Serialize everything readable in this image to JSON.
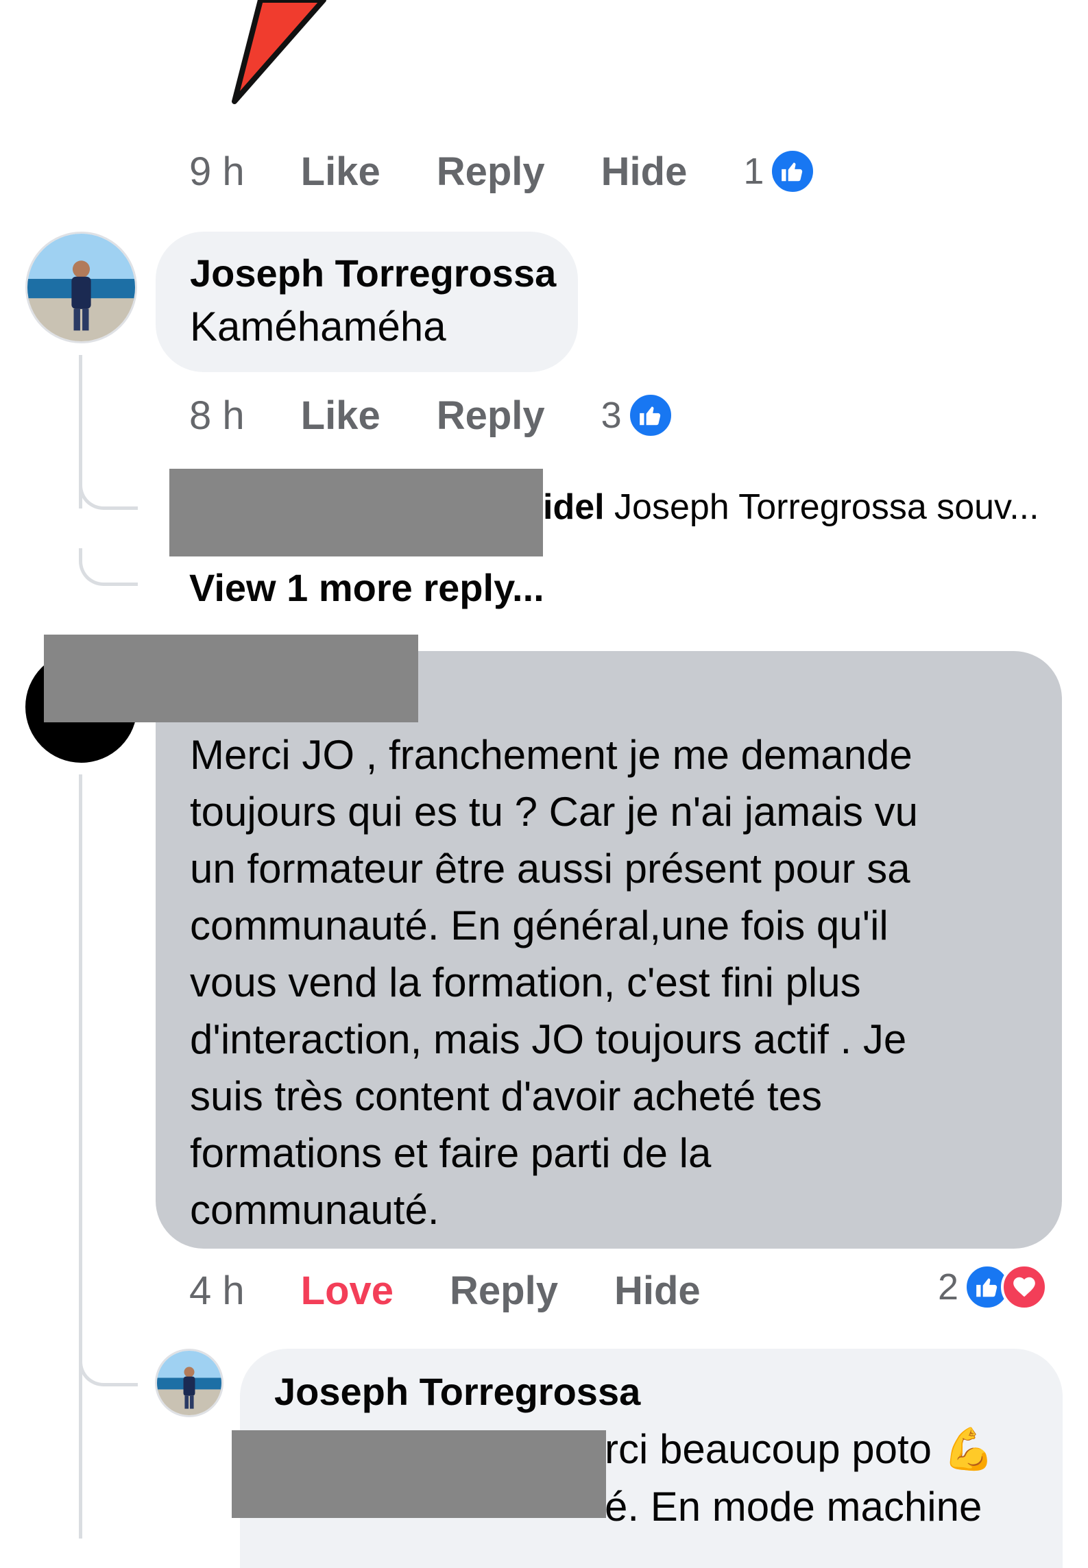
{
  "comment1_actions": {
    "time": "9 h",
    "like": "Like",
    "reply": "Reply",
    "hide": "Hide",
    "reaction_count": "1"
  },
  "comment2": {
    "author": "Joseph Torregrossa",
    "text": "Kaméhaméha",
    "actions": {
      "time": "8 h",
      "like": "Like",
      "reply": "Reply",
      "reaction_count": "3"
    },
    "reply_preview": {
      "author_tail": "idel",
      "text": "Joseph Torregrossa souv..."
    },
    "view_more": "View 1 more reply..."
  },
  "comment3": {
    "text": "Merci JO , franchement je me demande toujours qui es tu ? Car je n'ai jamais vu un formateur être aussi présent pour sa communauté. En général,une fois qu'il vous vend la formation, c'est fini plus d'interaction, mais JO toujours actif . Je suis très content d'avoir acheté tes formations et faire parti de la communauté.",
    "lines": [
      "Merci JO , franchement je me demande",
      "toujours qui es tu ? Car je n'ai jamais vu",
      "un formateur être aussi présent pour sa",
      "communauté. En général,une fois qu'il",
      "vous vend la formation, c'est fini plus",
      "d'interaction, mais JO toujours actif . Je",
      "suis très content d'avoir acheté tes",
      "formations et faire parti de la",
      "communauté."
    ],
    "actions": {
      "time": "4 h",
      "love": "Love",
      "reply": "Reply",
      "hide": "Hide",
      "reaction_count": "2"
    }
  },
  "reply1": {
    "author": "Joseph Torregrossa",
    "line1_visible": "rci beaucoup poto",
    "line1_emoji": "💪",
    "line2_visible": "é. En mode machine"
  },
  "icons": {
    "like": "thumbs-up-icon",
    "love": "heart-icon",
    "arrow": "red-arrow-icon"
  },
  "colors": {
    "like_blue": "#1877f2",
    "love_red": "#f33e58",
    "meta_grey": "#65676b",
    "bubble_light": "#f0f2f5",
    "bubble_highlight": "#c8cbd0",
    "arrow_red": "#f03c2e"
  }
}
